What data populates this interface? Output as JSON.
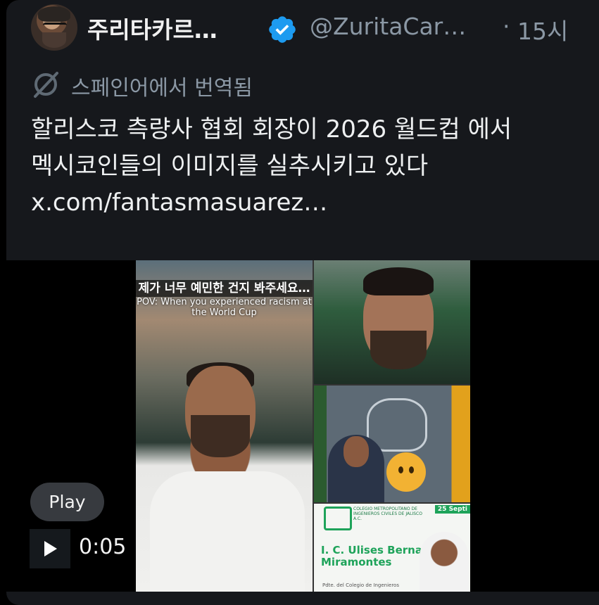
{
  "tweet": {
    "author_name": "주리타카르…",
    "handle": "@ZuritaCar…",
    "separator": "·",
    "timestamp": "15시",
    "translated_label": "스페인어에서 번역됨",
    "text_lines": [
      "할리스코 측량사 협회 회장이 2026 월드컵 에서",
      "멕시코인들의 이미지를 실추시키고 있다",
      "x.com/fantasmasuarez…"
    ]
  },
  "media": {
    "overlay_korean": "제가 너무 예민한 건지 봐주세요…",
    "overlay_english": "POV: When you experienced racism at the World Cup",
    "poster_org": "COLEGIO METROPOLITANO DE INGENIEROS CIVILES DE JALISCO A.C.",
    "poster_date": "25 Septi",
    "poster_name": "I. C. Ulises Bernal Miramontes",
    "poster_subtitle": "Pdte. del Colegio de Ingenieros",
    "play_label": "Play",
    "duration": "0:05"
  },
  "colors": {
    "card_bg": "#16181c",
    "verified": "#1d9bf0",
    "muted_text": "#8b98a5",
    "poster_green": "#1ea35a"
  },
  "icons": {
    "verified": "verified-badge-icon",
    "translate": "translate-icon",
    "play": "play-icon"
  }
}
